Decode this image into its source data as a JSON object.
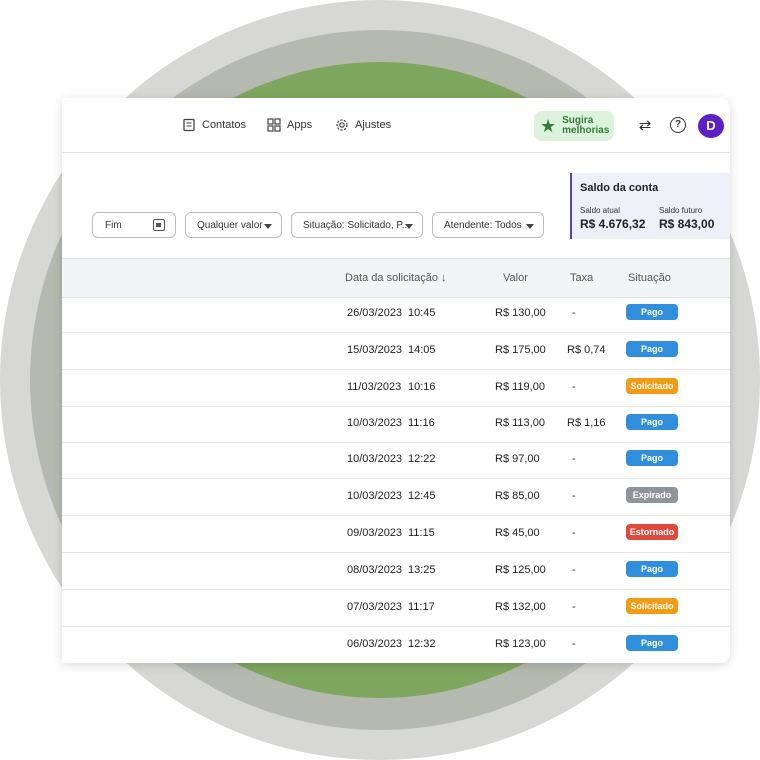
{
  "colors": {
    "ring_outer": "#d7d8d5",
    "ring_mid": "#b5b9b0",
    "ring_green": "#7fa65e",
    "accent_purple": "#5d1fc6",
    "suggest_bg": "#dcf2dd",
    "suggest_text": "#2f7d36",
    "balance_border": "#5046c8"
  },
  "header": {
    "nav": [
      {
        "label": "Contatos",
        "icon": "contacts-icon"
      },
      {
        "label": "Apps",
        "icon": "apps-grid-icon"
      },
      {
        "label": "Ajustes",
        "icon": "gear-icon"
      }
    ],
    "suggest_line1": "Sugira",
    "suggest_line2": "melhorias",
    "swap_icon": "swap-arrows-icon",
    "help_icon": "help-icon",
    "avatar_initial": "D"
  },
  "filters": {
    "end_date": "Fim",
    "value": "Qualquer valor",
    "status": "Situação: Solicitado, P...",
    "attendant": "Atendente: Todos"
  },
  "balance": {
    "title": "Saldo da conta",
    "current_label": "Saldo atual",
    "current_value": "R$ 4.676,32",
    "future_label": "Saldo futuro",
    "future_value": "R$ 843,00"
  },
  "table": {
    "headers": {
      "date": "Data da solicitação ↓",
      "value": "Valor",
      "fee": "Taxa",
      "status": "Situação"
    },
    "rows": [
      {
        "date": "26/03/2023",
        "time": "10:45",
        "value": "R$ 130,00",
        "fee": "-",
        "status": "Pago",
        "color": "#2f8fdd"
      },
      {
        "date": "15/03/2023",
        "time": "14:05",
        "value": "R$ 175,00",
        "fee": "R$ 0,74",
        "status": "Pago",
        "color": "#2f8fdd"
      },
      {
        "date": "11/03/2023",
        "time": "10:16",
        "value": "R$ 119,00",
        "fee": "-",
        "status": "Solicitado",
        "color": "#f39b12"
      },
      {
        "date": "10/03/2023",
        "time": "11:16",
        "value": "R$ 113,00",
        "fee": "R$ 1,16",
        "status": "Pago",
        "color": "#2f8fdd"
      },
      {
        "date": "10/03/2023",
        "time": "12:22",
        "value": "R$ 97,00",
        "fee": "-",
        "status": "Pago",
        "color": "#2f8fdd"
      },
      {
        "date": "10/03/2023",
        "time": "12:45",
        "value": "R$ 85,00",
        "fee": "-",
        "status": "Expirado",
        "color": "#8e9599"
      },
      {
        "date": "09/03/2023",
        "time": "11:15",
        "value": "R$ 45,00",
        "fee": "-",
        "status": "Estornado",
        "color": "#e04a3c"
      },
      {
        "date": "08/03/2023",
        "time": "13:25",
        "value": "R$ 125,00",
        "fee": "-",
        "status": "Pago",
        "color": "#2f8fdd"
      },
      {
        "date": "07/03/2023",
        "time": "11:17",
        "value": "R$ 132,00",
        "fee": "-",
        "status": "Solicitado",
        "color": "#f39b12"
      },
      {
        "date": "06/03/2023",
        "time": "12:32",
        "value": "R$ 123,00",
        "fee": "-",
        "status": "Pago",
        "color": "#2f8fdd"
      }
    ]
  }
}
